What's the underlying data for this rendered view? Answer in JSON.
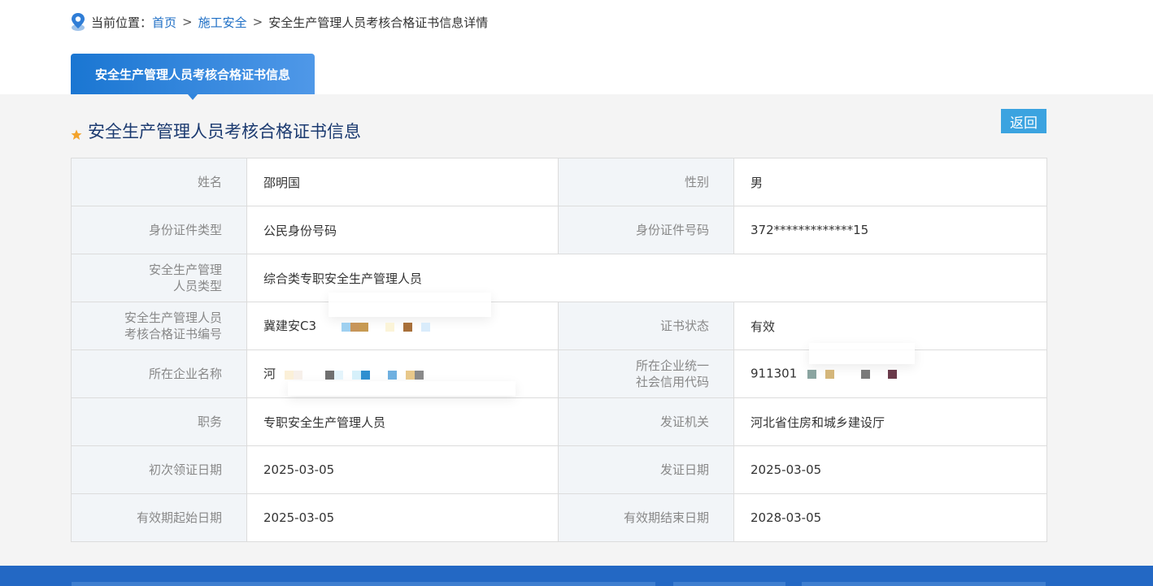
{
  "breadcrumb": {
    "prefix": "当前位置：",
    "home": "首页",
    "separator": ">",
    "section": "施工安全",
    "current": "安全生产管理人员考核合格证书信息详情"
  },
  "tab": {
    "label": "安全生产管理人员考核合格证书信息"
  },
  "section": {
    "title": "安全生产管理人员考核合格证书信息",
    "icon": "star-icon"
  },
  "back_button": {
    "label": "返回"
  },
  "fields": {
    "name": {
      "label": "姓名",
      "value": "邵明国"
    },
    "gender": {
      "label": "性别",
      "value": "男"
    },
    "id_type": {
      "label": "身份证件类型",
      "value": "公民身份号码"
    },
    "id_number": {
      "label": "身份证件号码",
      "value": "372*************15"
    },
    "staff_type": {
      "label_line1": "安全生产管理",
      "label_line2": "人员类型",
      "value": "综合类专职安全生产管理人员"
    },
    "cert_number": {
      "label_line1": "安全生产管理人员",
      "label_line2": "考核合格证书编号",
      "value": "冀建安C3"
    },
    "cert_status": {
      "label": "证书状态",
      "value": "有效"
    },
    "company_name": {
      "label": "所在企业名称",
      "value": "河"
    },
    "credit_code": {
      "label_line1": "所在企业统一",
      "label_line2": "社会信用代码",
      "value": "911301"
    },
    "position": {
      "label": "职务",
      "value": "专职安全生产管理人员"
    },
    "issuer": {
      "label": "发证机关",
      "value": "河北省住房和城乡建设厅"
    },
    "first_issue_date": {
      "label": "初次领证日期",
      "value": "2025-03-05"
    },
    "issue_date": {
      "label": "发证日期",
      "value": "2025-03-05"
    },
    "valid_from": {
      "label": "有效期起始日期",
      "value": "2025-03-05"
    },
    "valid_to": {
      "label": "有效期结束日期",
      "value": "2028-03-05"
    }
  },
  "colors": {
    "accent": "#1a76d2",
    "back_button": "#3ba3e0",
    "title": "#1b3a70",
    "footer": "#2368c4"
  }
}
